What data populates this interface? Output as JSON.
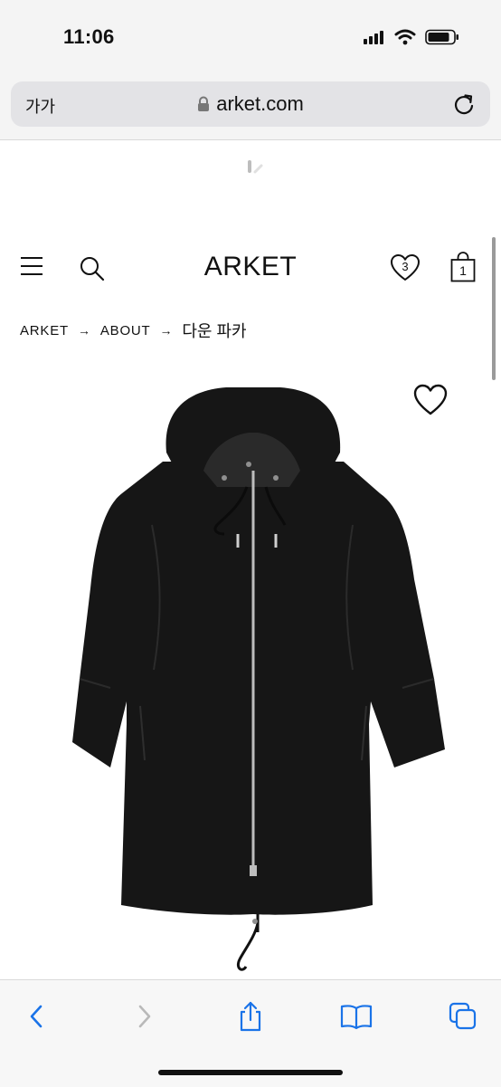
{
  "status_bar": {
    "time": "11:06"
  },
  "browser": {
    "text_size_label": "가가",
    "url": "arket.com"
  },
  "header": {
    "logo": "ARKET",
    "wishlist_count": "3",
    "bag_count": "1"
  },
  "breadcrumb": [
    {
      "label": "ARKET"
    },
    {
      "label": "ABOUT"
    },
    {
      "label": "다운 파카"
    }
  ],
  "icons": {
    "menu": "hamburger-icon",
    "search": "search-icon",
    "wishlist": "heart-icon",
    "bag": "shopping-bag-icon",
    "favorite": "heart-outline-icon",
    "back": "chevron-left-icon",
    "forward": "chevron-right-icon",
    "share": "share-icon",
    "bookmarks": "book-icon",
    "tabs": "tabs-icon"
  },
  "colors": {
    "toolbar_accent": "#1a73e8",
    "disabled": "#b9b9b9",
    "product": "#161616"
  }
}
